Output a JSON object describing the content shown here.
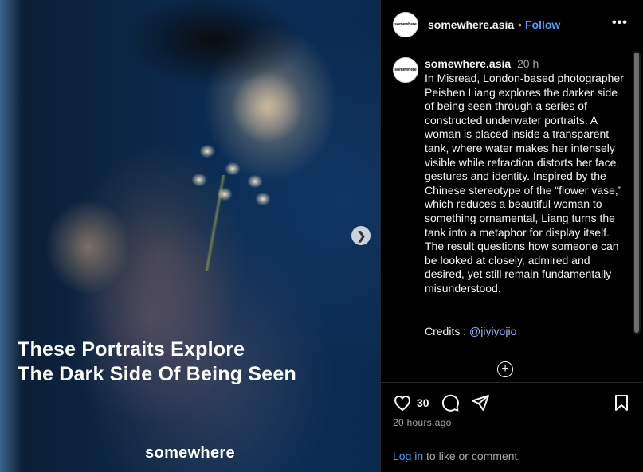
{
  "media": {
    "headline_line1": "These Portraits Explore",
    "headline_line2": "The Dark Side Of Being Seen",
    "brand": "somewhere",
    "next_icon": "chevron-right-icon"
  },
  "header": {
    "avatar_text": "somewhere",
    "username": "somewhere.asia",
    "separator": "•",
    "follow_label": "Follow",
    "more_icon": "more-horizontal-icon"
  },
  "caption": {
    "avatar_text": "somewhere",
    "username": "somewhere.asia",
    "time": "20 h",
    "text": "In Misread, London-based photographer Peishen Liang explores the darker side of being seen through a series of constructed underwater portraits. A woman is placed inside a transparent tank, where water makes her intensely visible while refraction distorts her face, gestures and identity. Inspired by the Chinese stereotype of the “flower vase,” which reduces a beautiful woman to something ornamental, Liang turns the tank into a metaphor for display itself. The result questions how someone can be looked at closely, admired and desired, yet still remain fundamentally misunderstood.",
    "credits_label": "Credits : ",
    "credits_handle": "@jiyiyojio",
    "load_more_icon": "plus-circle-icon"
  },
  "actions": {
    "like_count": "30",
    "posted": "20 hours ago",
    "login_link": "Log in",
    "login_suffix": " to like or comment."
  },
  "colors": {
    "background": "#000000",
    "link_blue": "#4a9eff",
    "credits_link": "#a0b6ff",
    "muted_text": "#a8a8a8"
  }
}
